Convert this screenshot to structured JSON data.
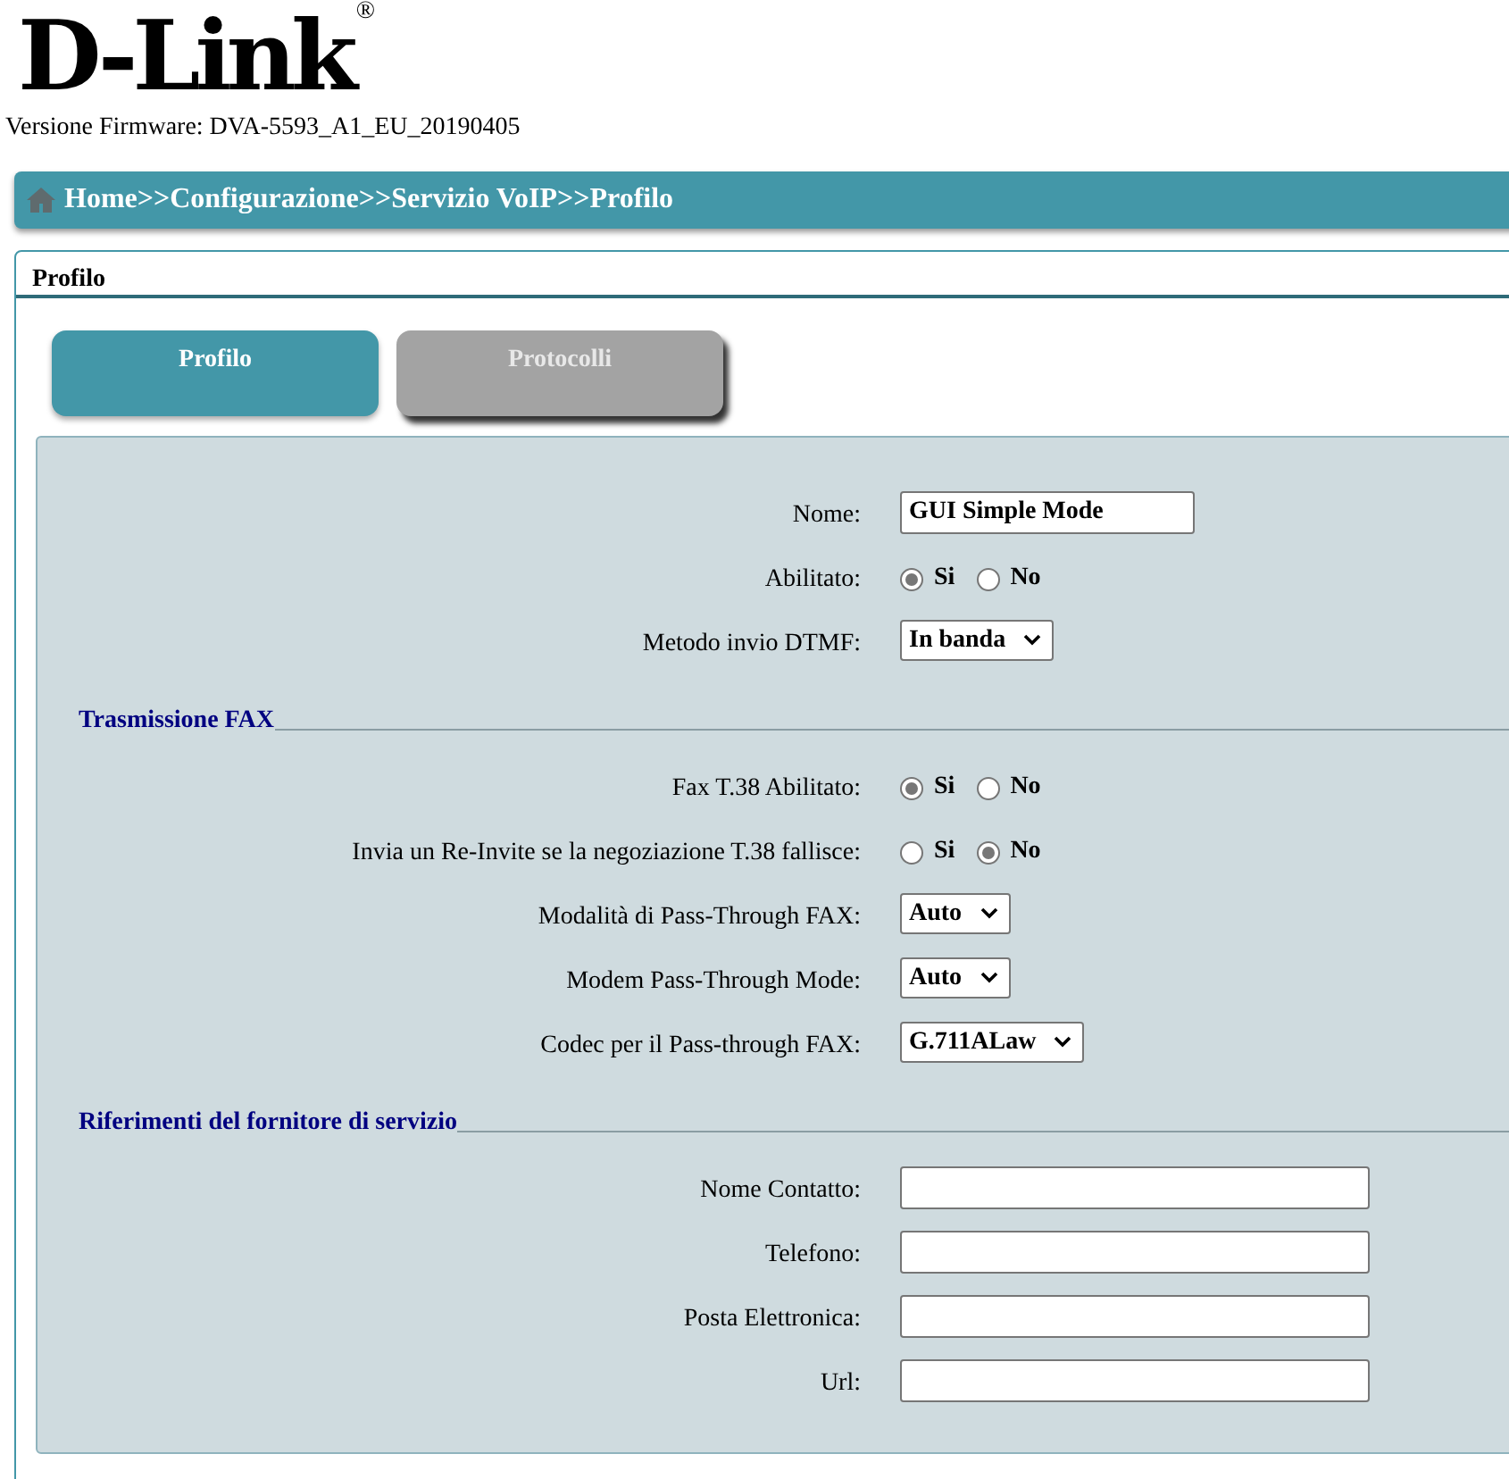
{
  "logo": {
    "text": "D-Link",
    "mark": "®"
  },
  "firmware": "Versione Firmware: DVA-5593_A1_EU_20190405",
  "breadcrumb": "Home>>Configurazione>>Servizio VoIP>>Profilo",
  "frame_title": "Profilo",
  "tabs": [
    {
      "label": "Profilo",
      "selected": true
    },
    {
      "label": "Protocolli",
      "selected": false
    }
  ],
  "sections": [
    {
      "rows": [
        {
          "kind": "text",
          "label": "Nome:",
          "value": "GUI Simple Mode"
        },
        {
          "kind": "radio",
          "label": "Abilitato:",
          "options": [
            {
              "label": "Si",
              "selected": true
            },
            {
              "label": "No",
              "selected": false
            }
          ]
        },
        {
          "kind": "select",
          "label": "Metodo invio DTMF:",
          "value": "In banda"
        }
      ]
    },
    {
      "title": "Trasmissione FAX",
      "rows": [
        {
          "kind": "radio",
          "label": "Fax T.38 Abilitato:",
          "options": [
            {
              "label": "Si",
              "selected": true
            },
            {
              "label": "No",
              "selected": false
            }
          ]
        },
        {
          "kind": "radio",
          "label": "Invia un Re-Invite se la negoziazione T.38 fallisce:",
          "options": [
            {
              "label": "Si",
              "selected": false
            },
            {
              "label": "No",
              "selected": true
            }
          ]
        },
        {
          "kind": "select",
          "label": "Modalità di Pass-Through FAX:",
          "value": "Auto"
        },
        {
          "kind": "select",
          "label": "Modem Pass-Through Mode:",
          "value": "Auto"
        },
        {
          "kind": "select",
          "label": "Codec per il Pass-through FAX:",
          "value": "G.711ALaw"
        }
      ]
    },
    {
      "title": "Riferimenti del fornitore di servizio",
      "rows": [
        {
          "kind": "text",
          "label": "Nome Contatto:",
          "value": ""
        },
        {
          "kind": "text",
          "label": "Telefono:",
          "value": ""
        },
        {
          "kind": "text",
          "label": "Posta Elettronica:",
          "value": ""
        },
        {
          "kind": "text",
          "label": "Url:",
          "value": ""
        }
      ]
    }
  ]
}
